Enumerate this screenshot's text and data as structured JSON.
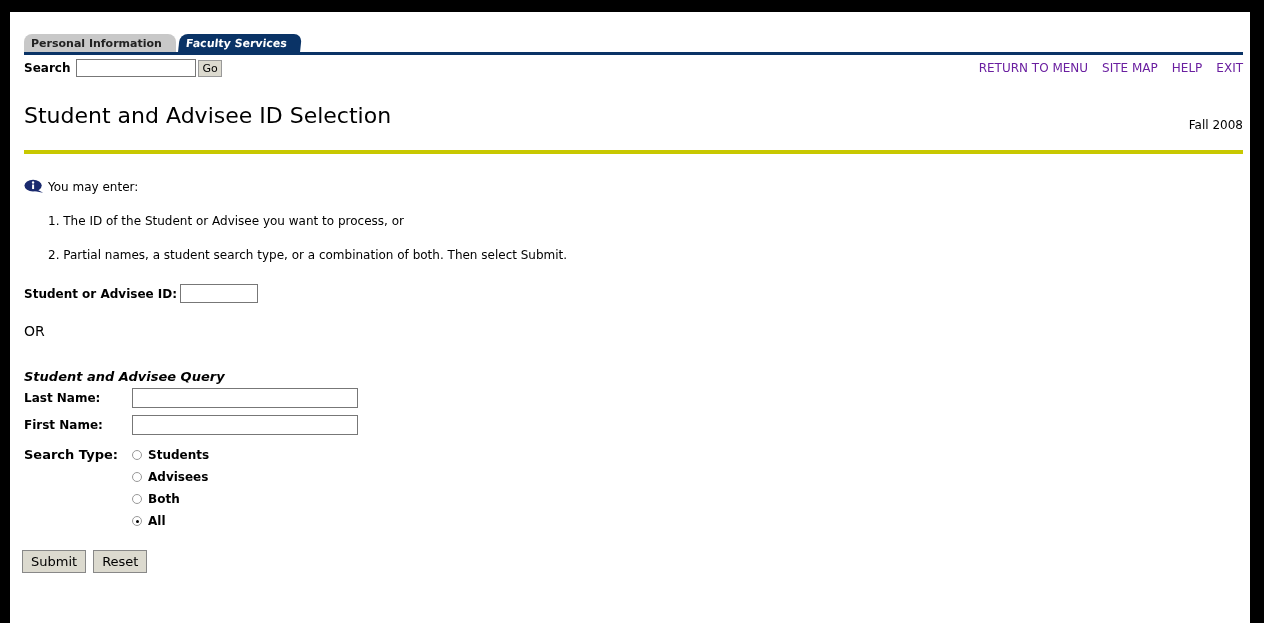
{
  "tabs": [
    {
      "label": "Personal Information",
      "selected": false
    },
    {
      "label": "Faculty Services",
      "selected": true
    }
  ],
  "search": {
    "label": "Search",
    "button": "Go"
  },
  "nav_links": [
    "RETURN TO MENU",
    "SITE MAP",
    "HELP",
    "EXIT"
  ],
  "page_title": "Student and Advisee ID Selection",
  "term": "Fall 2008",
  "info": {
    "intro": "You may enter:",
    "items": [
      "1. The ID of the Student or Advisee you want to process, or",
      "2. Partial names, a student search type, or a combination of both. Then select Submit."
    ]
  },
  "id_field": {
    "label": "Student or Advisee ID:"
  },
  "or_label": "OR",
  "query": {
    "heading": "Student and Advisee Query",
    "fields": [
      {
        "label": "Last Name:"
      },
      {
        "label": "First Name:"
      }
    ],
    "search_type": {
      "label": "Search Type:",
      "options": [
        {
          "label": "Students",
          "selected": false
        },
        {
          "label": "Advisees",
          "selected": false
        },
        {
          "label": "Both",
          "selected": false
        },
        {
          "label": "All",
          "selected": true
        }
      ]
    }
  },
  "buttons": [
    "Submit",
    "Reset"
  ]
}
